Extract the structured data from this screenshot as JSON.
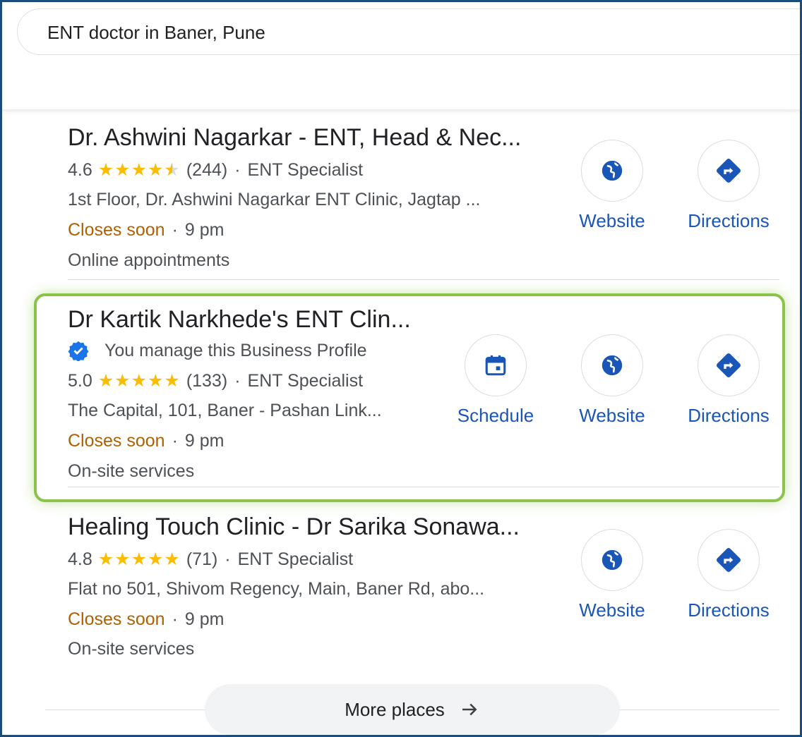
{
  "search": {
    "query": "ENT doctor in Baner, Pune"
  },
  "listings": [
    {
      "name": "Dr. Ashwini Nagarkar - ENT, Head & Nec...",
      "rating": "4.6",
      "stars_value": 4.5,
      "reviews": "(244)",
      "category": "ENT Specialist",
      "address": "1st Floor, Dr. Ashwini Nagarkar ENT Clinic, Jagtap ...",
      "status": "Closes soon",
      "close_time": "9 pm",
      "extra": "Online appointments",
      "website_label": "Website",
      "directions_label": "Directions"
    },
    {
      "name": "Dr Kartik Narkhede's ENT Clin...",
      "managed_text": "You manage this Business Profile",
      "rating": "5.0",
      "stars_value": 5,
      "reviews": "(133)",
      "category": "ENT Specialist",
      "address": "The Capital, 101, Baner - Pashan Link...",
      "status": "Closes soon",
      "close_time": "9 pm",
      "extra": "On-site services",
      "schedule_label": "Schedule",
      "website_label": "Website",
      "directions_label": "Directions"
    },
    {
      "name": "Healing Touch Clinic - Dr Sarika Sonawa...",
      "rating": "4.8",
      "stars_value": 5,
      "reviews": "(71)",
      "category": "ENT Specialist",
      "address": "Flat no 501, Shivom Regency, Main, Baner Rd, abo...",
      "status": "Closes soon",
      "close_time": "9 pm",
      "extra": "On-site services",
      "website_label": "Website",
      "directions_label": "Directions"
    }
  ],
  "more_places": {
    "label": "More places"
  },
  "colors": {
    "link_blue": "#1a56b8",
    "star": "#fbbc04",
    "closes": "#b06000",
    "highlight": "#8bc34a"
  }
}
